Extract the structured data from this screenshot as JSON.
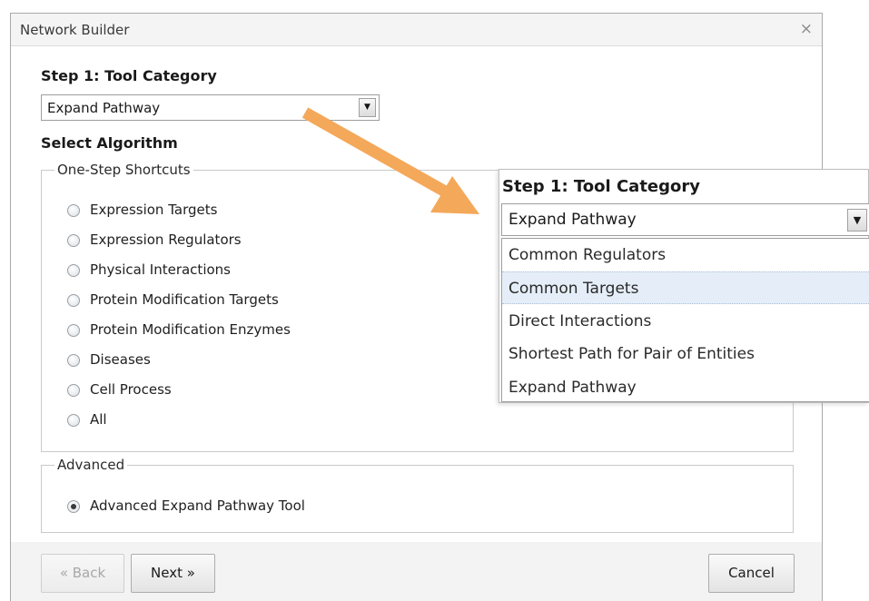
{
  "window": {
    "title": "Network Builder",
    "close_glyph": "×"
  },
  "step1": {
    "heading": "Step 1: Tool Category",
    "selected": "Expand Pathway",
    "dropdown_glyph": "▼"
  },
  "select_algorithm": {
    "heading": "Select Algorithm"
  },
  "one_step": {
    "legend": "One-Step Shortcuts",
    "options": [
      {
        "label": "Expression Targets",
        "checked": false
      },
      {
        "label": "Expression Regulators",
        "checked": false
      },
      {
        "label": "Physical Interactions",
        "checked": false
      },
      {
        "label": "Protein Modification Targets",
        "checked": false
      },
      {
        "label": "Protein Modification Enzymes",
        "checked": false
      },
      {
        "label": "Diseases",
        "checked": false
      },
      {
        "label": "Cell Process",
        "checked": false
      },
      {
        "label": "All",
        "checked": false
      }
    ]
  },
  "advanced": {
    "legend": "Advanced",
    "options": [
      {
        "label": "Advanced Expand Pathway Tool",
        "checked": true
      }
    ]
  },
  "footer": {
    "back_label": "« Back",
    "next_label": "Next »",
    "cancel_label": "Cancel"
  },
  "zoom_callout": {
    "heading": "Step 1: Tool Category",
    "selected": "Expand Pathway",
    "dropdown_glyph": "▼",
    "items": [
      {
        "label": "Common Regulators",
        "hover": false
      },
      {
        "label": "Common Targets",
        "hover": true
      },
      {
        "label": "Direct Interactions",
        "hover": false
      },
      {
        "label": "Shortest Path for Pair of Entities",
        "hover": false
      },
      {
        "label": "Expand Pathway",
        "hover": false
      }
    ]
  },
  "colors": {
    "arrow": "#f4a85a",
    "hover_bg": "#e5eef8"
  }
}
